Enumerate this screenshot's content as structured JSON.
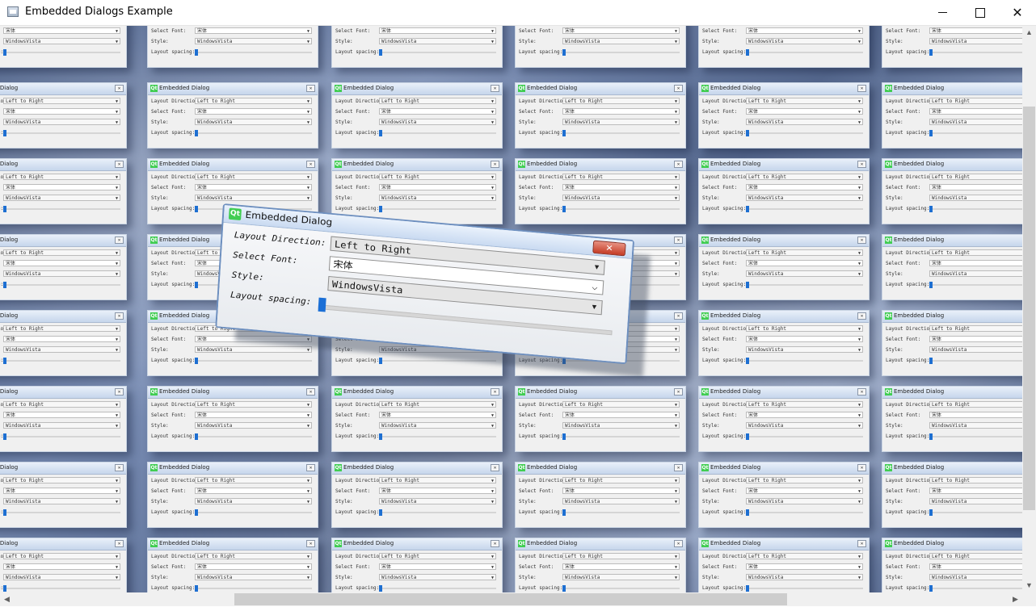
{
  "window": {
    "title": "Embedded Dialogs Example",
    "minimize_glyph": "",
    "maximize_glyph": "",
    "close_glyph": "✕"
  },
  "dialog": {
    "title": "Embedded Dialog",
    "qt_logo_text": "Qt",
    "close_glyph": "✕",
    "layout_direction_label": "Layout Direction:",
    "layout_direction_value": "Left to Right",
    "select_font_label": "Select Font:",
    "select_font_value": "宋体",
    "style_label": "Style:",
    "style_value": "WindowsVista",
    "layout_spacing_label": "Layout spacing:",
    "layout_spacing_fraction": 0.0
  },
  "scrollbars": {
    "up_glyph": "▲",
    "down_glyph": "▼",
    "left_glyph": "◀",
    "right_glyph": "▶"
  },
  "colors": {
    "slider_accent": "#1b6fd6",
    "close_button": "#c53c25",
    "qt_green": "#41cd52"
  }
}
